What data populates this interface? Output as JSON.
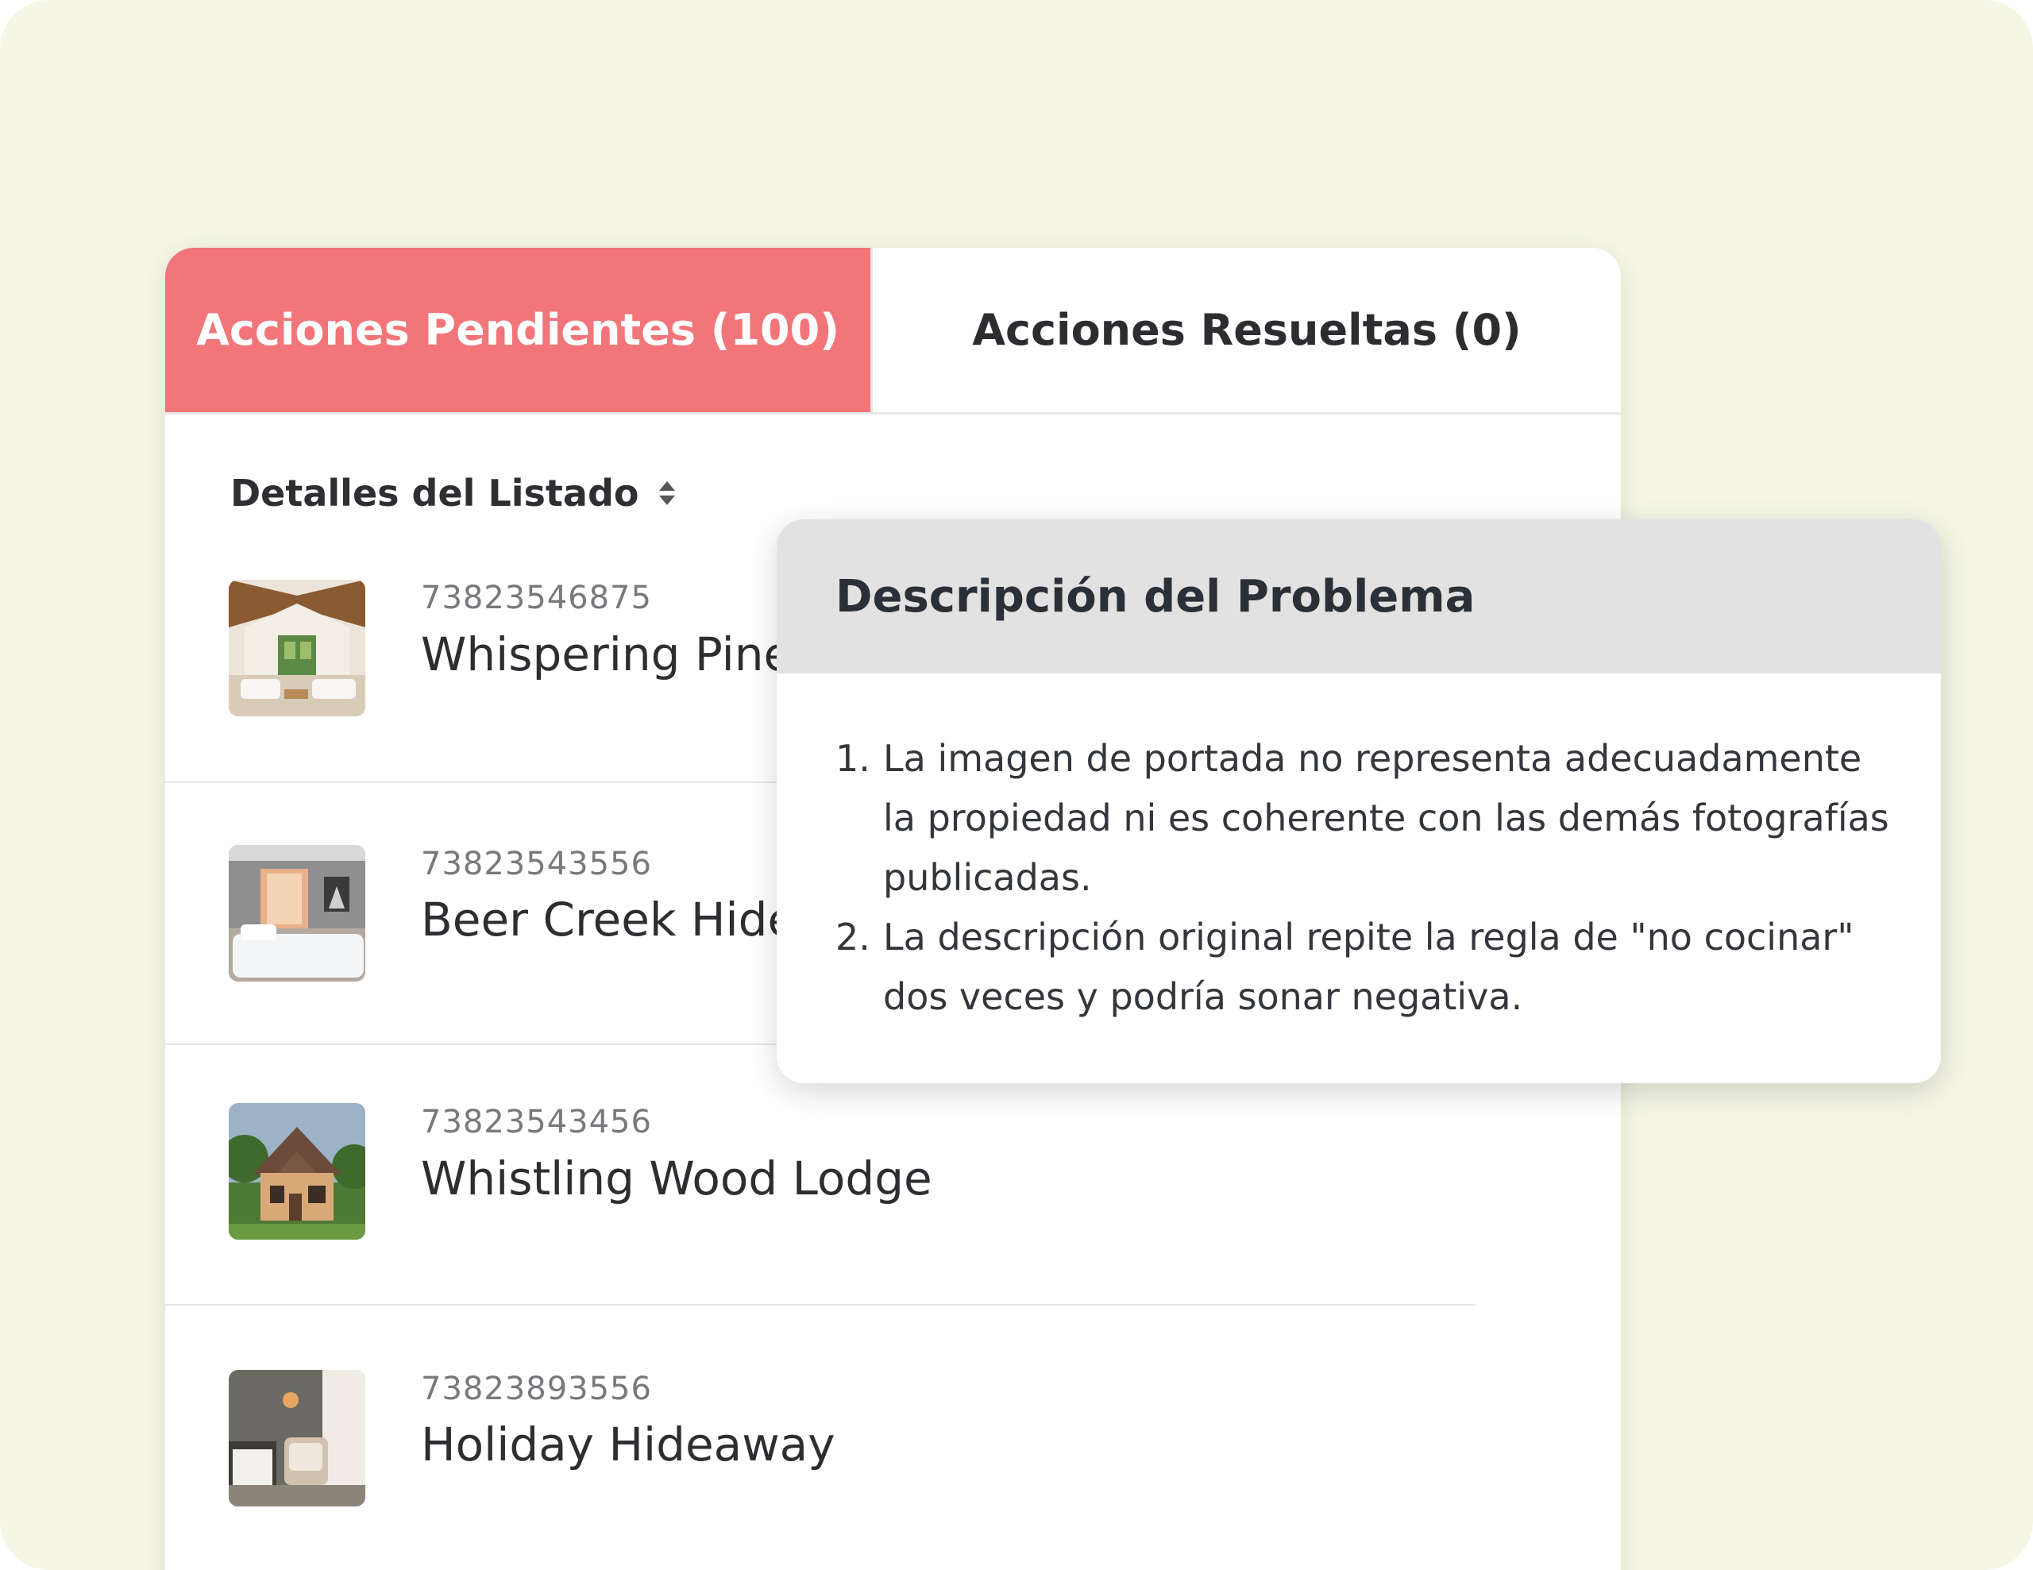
{
  "colors": {
    "accent": "#f27579",
    "background": "#f5f6e6",
    "popover_header": "#e2e2e2"
  },
  "tabs": [
    {
      "label": "Acciones Pendientes (100)",
      "active": true
    },
    {
      "label": "Acciones Resueltas (0)",
      "active": false
    }
  ],
  "list": {
    "header": "Detalles del Listado",
    "sort_icon": "sort-icon",
    "rows": [
      {
        "id": "73823546875",
        "name": "Whispering Pines",
        "thumbnail": "cabin-interior-photo"
      },
      {
        "id": "73823543556",
        "name": "Beer Creek Hideaway",
        "thumbnail": "bedroom-photo"
      },
      {
        "id": "73823543456",
        "name": "Whistling Wood Lodge",
        "thumbnail": "house-exterior-photo"
      },
      {
        "id": "73823893556",
        "name": "Holiday Hideaway",
        "thumbnail": "reading-nook-photo"
      }
    ]
  },
  "problem_popover": {
    "title": "Descripción del Problema",
    "issues": [
      {
        "number": "1.",
        "text": "La imagen de portada no representa adecuadamente la propiedad ni es coherente con las demás fotografías publicadas."
      },
      {
        "number": "2.",
        "text": "La descripción original repite la regla de \"no cocinar\" dos veces y podría sonar negativa."
      }
    ]
  }
}
